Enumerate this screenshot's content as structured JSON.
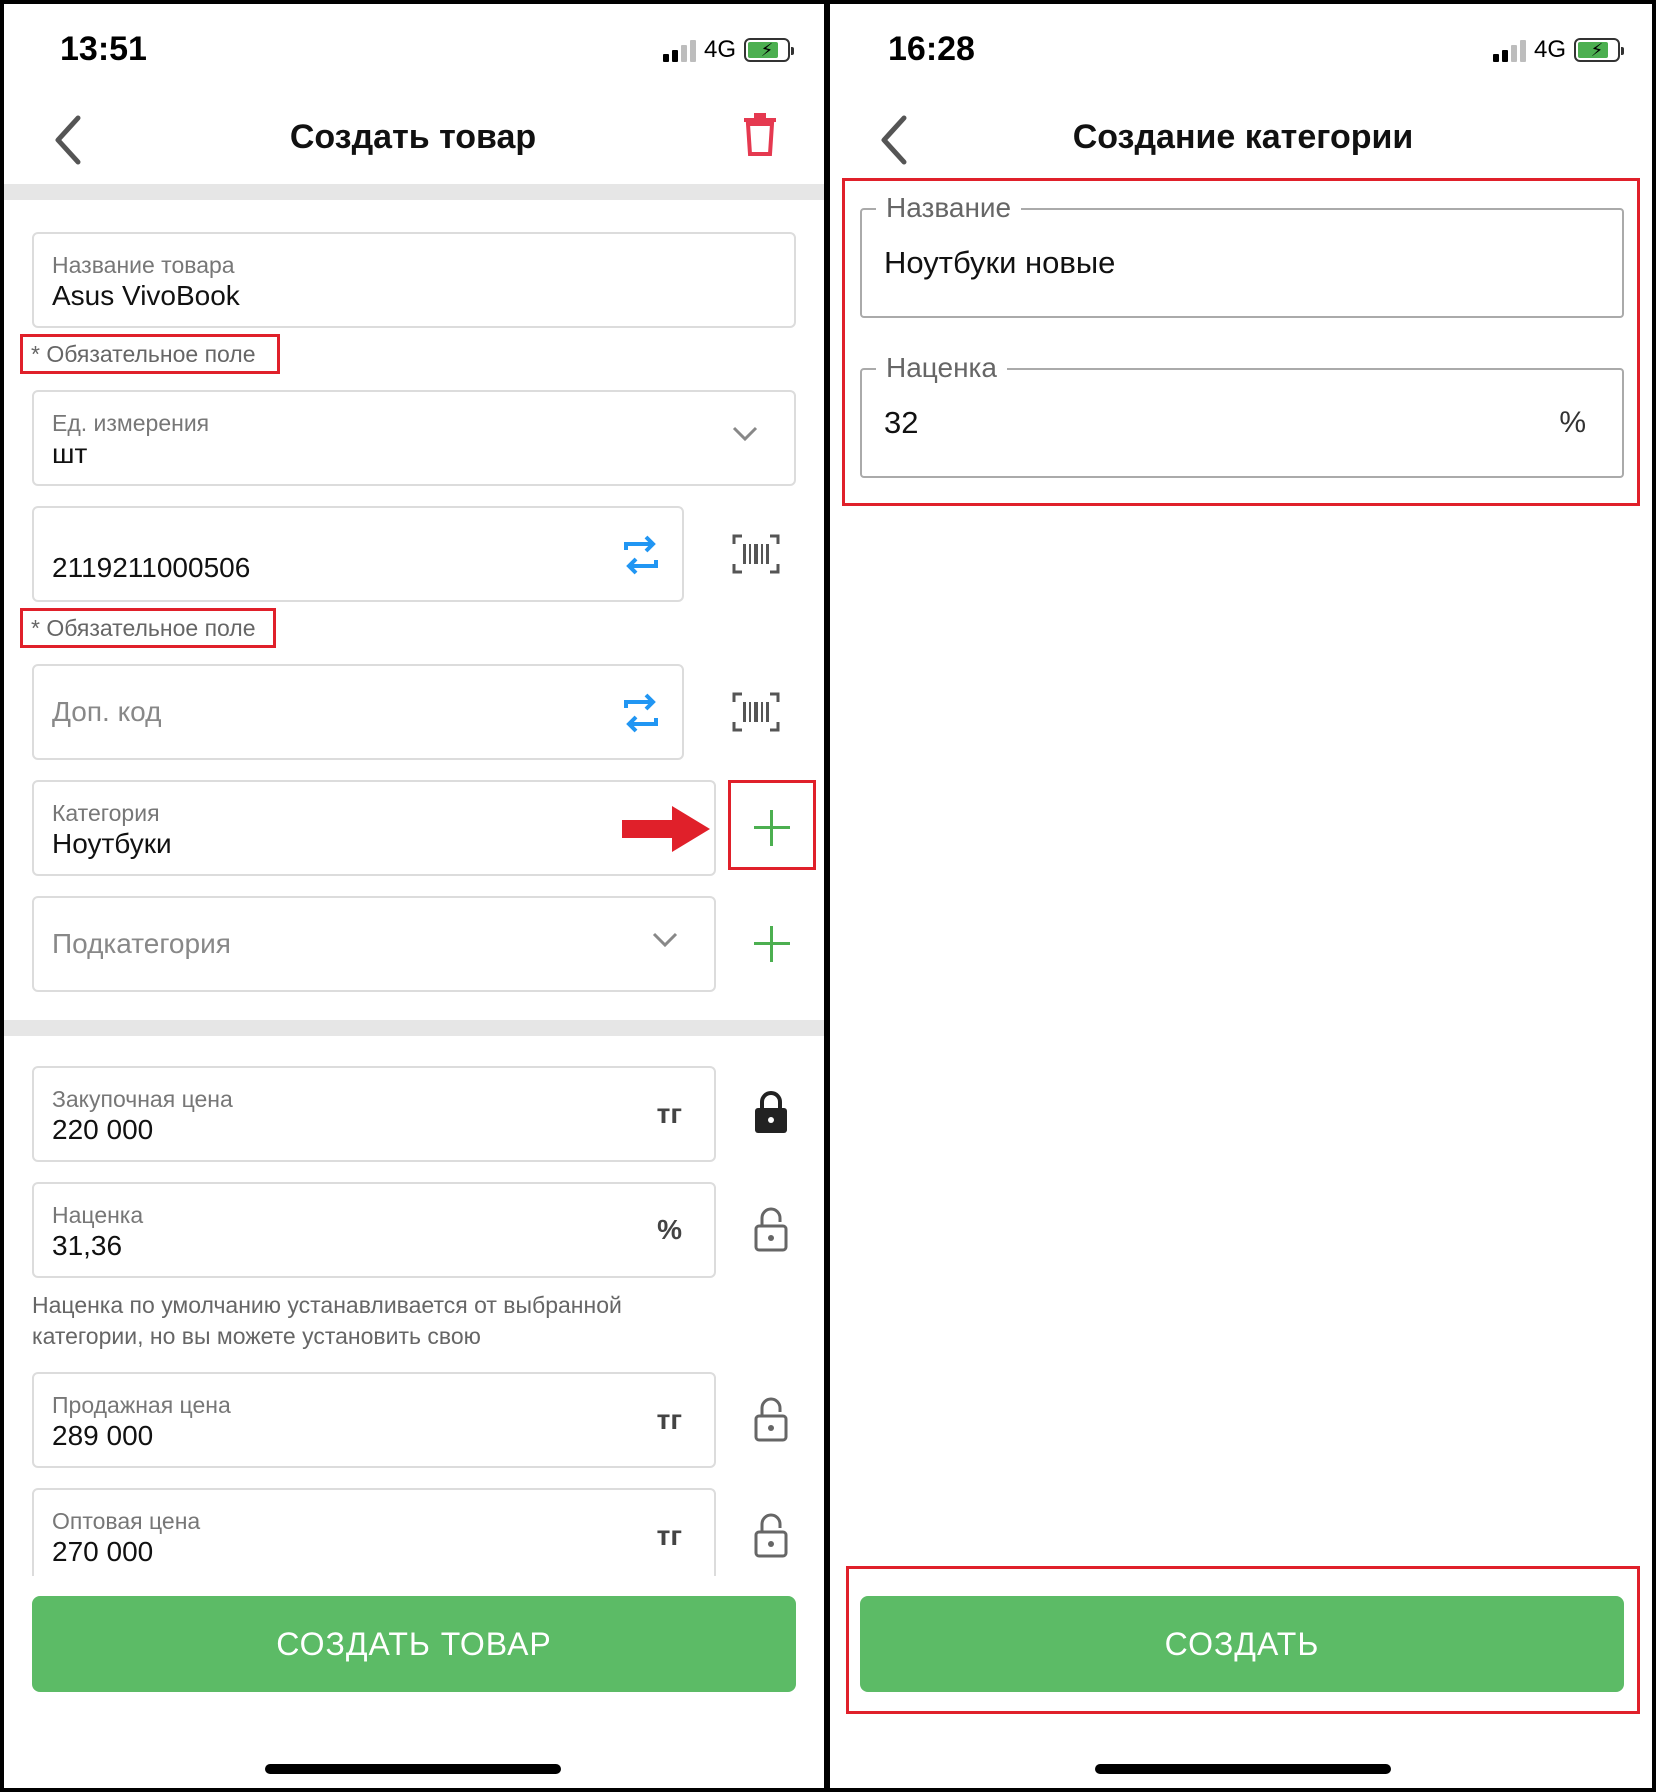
{
  "left": {
    "status": {
      "time": "13:51",
      "network": "4G"
    },
    "nav": {
      "title": "Создать товар"
    },
    "product_name": {
      "label": "Название товара",
      "value": "Asus VivoBook"
    },
    "required_note": "* Обязательное поле",
    "unit": {
      "label": "Ед. измерения",
      "value": "шт"
    },
    "barcode": {
      "value": "2119211000506"
    },
    "extra_code": {
      "placeholder": "Доп. код"
    },
    "category": {
      "label": "Категория",
      "value": "Ноутбуки"
    },
    "subcategory": {
      "placeholder": "Подкатегория"
    },
    "purchase_price": {
      "label": "Закупочная цена",
      "value": "220 000",
      "unit": "тг"
    },
    "markup": {
      "label": "Наценка",
      "value": "31,36",
      "unit": "%"
    },
    "markup_hint": "Наценка по умолчанию устанавливается от выбранной категории, но вы можете установить свою",
    "sale_price": {
      "label": "Продажная цена",
      "value": "289 000",
      "unit": "тг"
    },
    "wholesale_price": {
      "label": "Оптовая цена",
      "value": "270 000",
      "unit": "тг"
    },
    "submit_label": "СОЗДАТЬ ТОВАР"
  },
  "right": {
    "status": {
      "time": "16:28",
      "network": "4G"
    },
    "nav": {
      "title": "Создание категории"
    },
    "name": {
      "label": "Название",
      "value": "Ноутбуки новые"
    },
    "markup": {
      "label": "Наценка",
      "value": "32",
      "unit": "%"
    },
    "submit_label": "СОЗДАТЬ"
  },
  "colors": {
    "accent": "#5cbb66",
    "highlight": "#e0202a",
    "delete": "#e53950",
    "swap": "#2196f3"
  },
  "icons": [
    "back-chevron-icon",
    "trash-icon",
    "chevron-down-icon",
    "swap-icon",
    "barcode-scan-icon",
    "plus-icon",
    "lock-icon",
    "unlock-icon",
    "arrow-right-icon",
    "battery-icon",
    "signal-icon"
  ]
}
